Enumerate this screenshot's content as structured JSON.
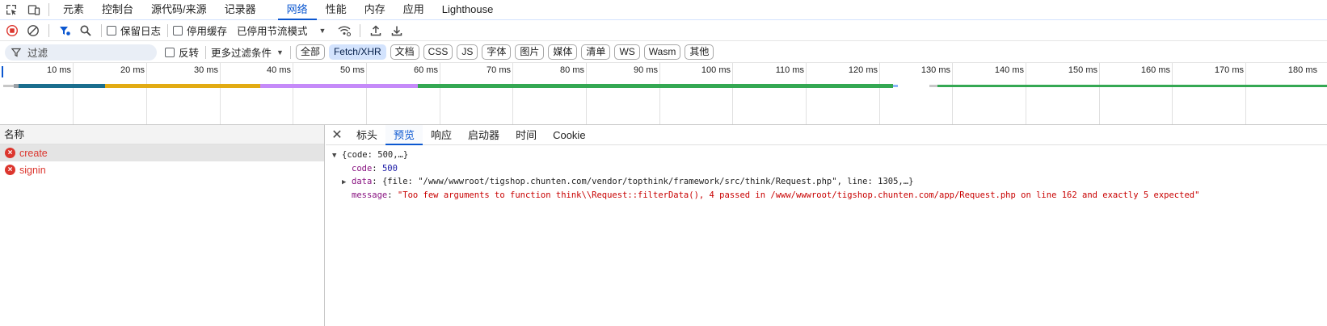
{
  "main_tabs": [
    "元素",
    "控制台",
    "源代码/来源",
    "记录器",
    "网络",
    "性能",
    "内存",
    "应用",
    "Lighthouse"
  ],
  "active_main_tab": "网络",
  "toolbar": {
    "preserve_log": "保留日志",
    "disable_cache": "停用缓存",
    "throttling": "已停用节流模式"
  },
  "filter_bar": {
    "placeholder": "过滤",
    "invert": "反转",
    "more_filters": "更多过滤条件",
    "chips": [
      "全部",
      "Fetch/XHR",
      "文档",
      "CSS",
      "JS",
      "字体",
      "图片",
      "媒体",
      "清单",
      "WS",
      "Wasm",
      "其他"
    ],
    "active_chip": "Fetch/XHR"
  },
  "timeline": {
    "ticks": [
      "10 ms",
      "20 ms",
      "30 ms",
      "40 ms",
      "50 ms",
      "60 ms",
      "70 ms",
      "80 ms",
      "90 ms",
      "100 ms",
      "110 ms",
      "120 ms",
      "130 ms",
      "140 ms",
      "150 ms",
      "160 ms",
      "170 ms",
      "180 ms"
    ],
    "colors": {
      "waiting": "#1a6e8e",
      "blocking": "#e2ab13",
      "sending": "#c58af9",
      "receiving": "#34a853"
    }
  },
  "request_list": {
    "header": "名称",
    "requests": [
      {
        "name": "create",
        "status": "error"
      },
      {
        "name": "signin",
        "status": "error"
      }
    ]
  },
  "detail_tabs": [
    "标头",
    "预览",
    "响应",
    "启动器",
    "时间",
    "Cookie"
  ],
  "active_detail_tab": "预览",
  "preview": {
    "summary": "{code: 500,…}",
    "code_key": "code",
    "code_value": "500",
    "data_key": "data",
    "data_value": "{file: \"/www/wwwroot/tigshop.chunten.com/vendor/topthink/framework/src/think/Request.php\", line: 1305,…}",
    "message_key": "message",
    "message_value": "\"Too few arguments to function think\\\\Request::filterData(), 4 passed in /www/wwwroot/tigshop.chunten.com/app/Request.php on line 162 and exactly 5 expected\""
  }
}
